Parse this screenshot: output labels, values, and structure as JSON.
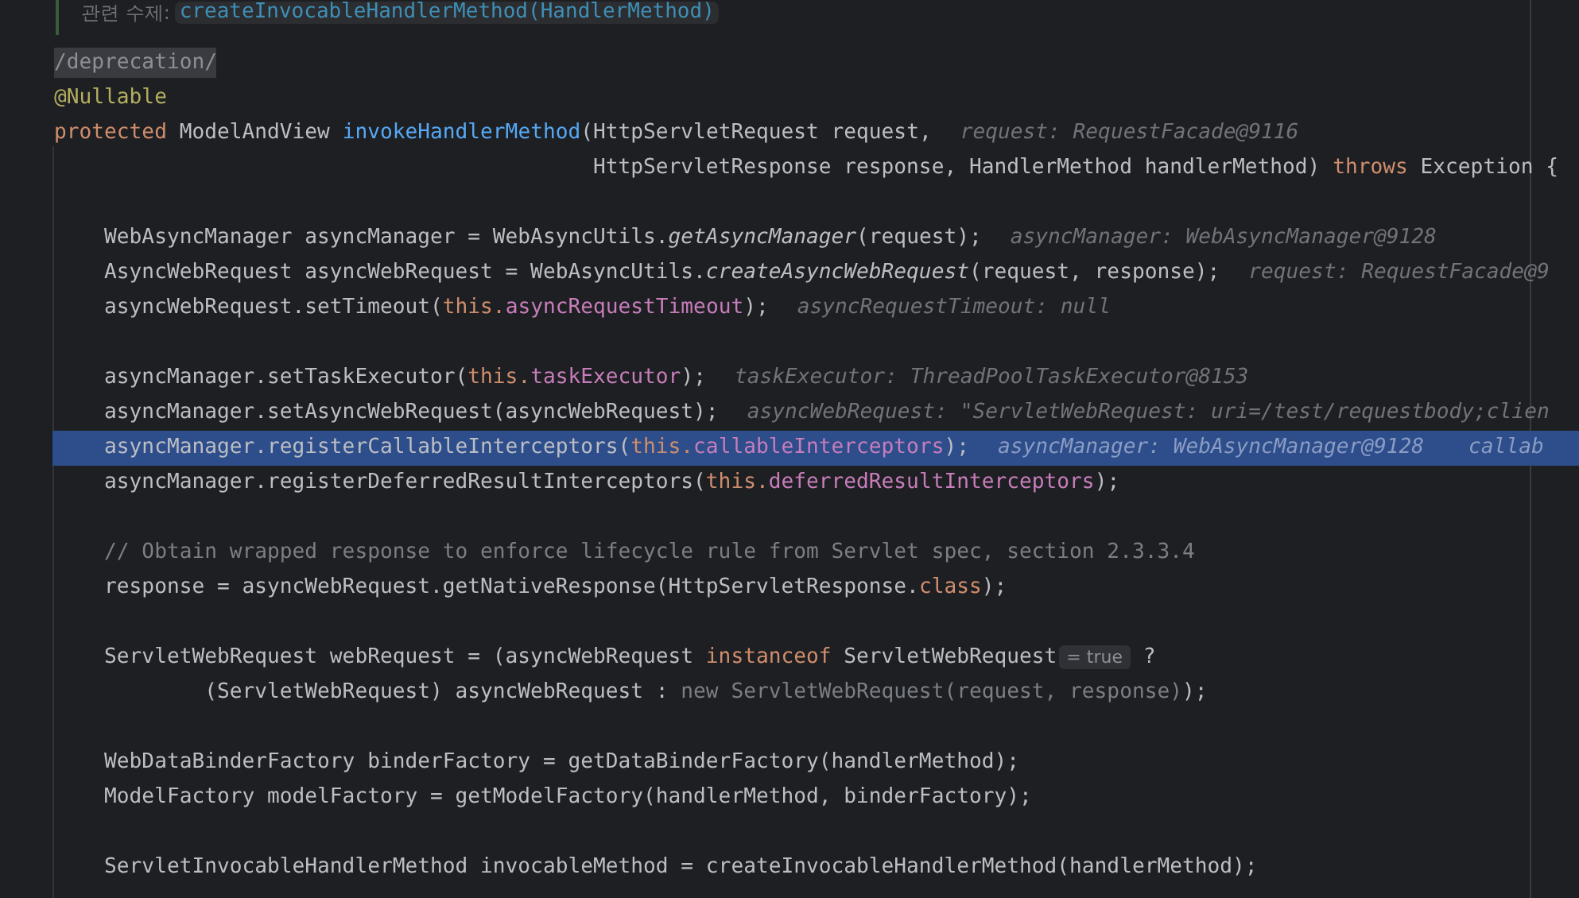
{
  "doc_note": {
    "label": "관련 수제:",
    "link": "createInvocableHandlerMethod(HandlerMethod)"
  },
  "lines": [
    {
      "selected": false,
      "tokens": [
        {
          "kind": "tag",
          "text": "/deprecation/"
        }
      ]
    },
    {
      "selected": false,
      "tokens": [
        {
          "kind": "annotation",
          "text": "@Nullable"
        }
      ]
    },
    {
      "selected": false,
      "tokens": [
        {
          "kind": "keyword",
          "text": "protected "
        },
        {
          "kind": "plain",
          "text": "ModelAndView "
        },
        {
          "kind": "decl",
          "text": "invokeHandlerMethod"
        },
        {
          "kind": "plain",
          "text": "(HttpServletRequest request,"
        }
      ],
      "hints": [
        "request: RequestFacade@9116"
      ]
    },
    {
      "selected": false,
      "tokens": [
        {
          "kind": "plain",
          "text": "                                           HttpServletResponse response, HandlerMethod handlerMethod) "
        },
        {
          "kind": "keyword",
          "text": "throws"
        },
        {
          "kind": "plain",
          "text": " Exception {"
        }
      ]
    },
    {
      "selected": false
    },
    {
      "selected": false,
      "tokens": [
        {
          "kind": "plain",
          "text": "    WebAsyncManager asyncManager = WebAsyncUtils."
        },
        {
          "kind": "static",
          "text": "getAsyncManager"
        },
        {
          "kind": "plain",
          "text": "(request);"
        }
      ],
      "hints": [
        "asyncManager: WebAsyncManager@9128"
      ]
    },
    {
      "selected": false,
      "tokens": [
        {
          "kind": "plain",
          "text": "    AsyncWebRequest asyncWebRequest = WebAsyncUtils."
        },
        {
          "kind": "static",
          "text": "createAsyncWebRequest"
        },
        {
          "kind": "plain",
          "text": "(request, response);"
        }
      ],
      "hints": [
        "request: RequestFacade@9"
      ]
    },
    {
      "selected": false,
      "tokens": [
        {
          "kind": "plain",
          "text": "    asyncWebRequest.setTimeout("
        },
        {
          "kind": "keyword",
          "text": "this."
        },
        {
          "kind": "field",
          "text": "asyncRequestTimeout"
        },
        {
          "kind": "plain",
          "text": ");"
        }
      ],
      "hints": [
        "asyncRequestTimeout: null"
      ]
    },
    {
      "selected": false
    },
    {
      "selected": false,
      "tokens": [
        {
          "kind": "plain",
          "text": "    asyncManager.setTaskExecutor("
        },
        {
          "kind": "keyword",
          "text": "this."
        },
        {
          "kind": "field",
          "text": "taskExecutor"
        },
        {
          "kind": "plain",
          "text": ");"
        }
      ],
      "hints": [
        "taskExecutor: ThreadPoolTaskExecutor@8153"
      ]
    },
    {
      "selected": false,
      "tokens": [
        {
          "kind": "plain",
          "text": "    asyncManager.setAsyncWebRequest(asyncWebRequest);"
        }
      ],
      "hints": [
        "asyncWebRequest: \"ServletWebRequest: uri=/test/requestbody;clien"
      ]
    },
    {
      "selected": true,
      "tokens": [
        {
          "kind": "plain",
          "text": "    asyncManager.registerCallableInterceptors("
        },
        {
          "kind": "keyword",
          "text": "this."
        },
        {
          "kind": "field",
          "text": "callableInterceptors"
        },
        {
          "kind": "plain",
          "text": ");"
        }
      ],
      "hints": [
        "asyncManager: WebAsyncManager@9128",
        "callab"
      ]
    },
    {
      "selected": false,
      "tokens": [
        {
          "kind": "plain",
          "text": "    asyncManager.registerDeferredResultInterceptors("
        },
        {
          "kind": "keyword",
          "text": "this."
        },
        {
          "kind": "field",
          "text": "deferredResultInterceptors"
        },
        {
          "kind": "plain",
          "text": ");"
        }
      ]
    },
    {
      "selected": false
    },
    {
      "selected": false,
      "tokens": [
        {
          "kind": "comment",
          "text": "    // Obtain wrapped response to enforce lifecycle rule from Servlet spec, section 2.3.3.4"
        }
      ]
    },
    {
      "selected": false,
      "tokens": [
        {
          "kind": "plain",
          "text": "    response = asyncWebRequest.getNativeResponse(HttpServletResponse."
        },
        {
          "kind": "keyword",
          "text": "class"
        },
        {
          "kind": "plain",
          "text": ");"
        }
      ]
    },
    {
      "selected": false
    },
    {
      "selected": false,
      "tokens": [
        {
          "kind": "plain",
          "text": "    ServletWebRequest webRequest = (asyncWebRequest "
        },
        {
          "kind": "keyword",
          "text": "instanceof"
        },
        {
          "kind": "plain",
          "text": " ServletWebRequest"
        },
        {
          "kind": "badge",
          "text": "= true"
        },
        {
          "kind": "plain",
          "text": " ?"
        }
      ]
    },
    {
      "selected": false,
      "tokens": [
        {
          "kind": "plain",
          "text": "            (ServletWebRequest) asyncWebRequest : "
        },
        {
          "kind": "dim",
          "text": "new ServletWebRequest(request, response)"
        },
        {
          "kind": "plain",
          "text": ");"
        }
      ]
    },
    {
      "selected": false
    },
    {
      "selected": false,
      "tokens": [
        {
          "kind": "plain",
          "text": "    WebDataBinderFactory binderFactory = getDataBinderFactory(handlerMethod);"
        }
      ]
    },
    {
      "selected": false,
      "tokens": [
        {
          "kind": "plain",
          "text": "    ModelFactory modelFactory = getModelFactory(handlerMethod, binderFactory);"
        }
      ]
    },
    {
      "selected": false
    },
    {
      "selected": false,
      "tokens": [
        {
          "kind": "plain",
          "text": "    ServletInvocableHandlerMethod invocableMethod = createInvocableHandlerMethod(handlerMethod);"
        }
      ]
    }
  ]
}
